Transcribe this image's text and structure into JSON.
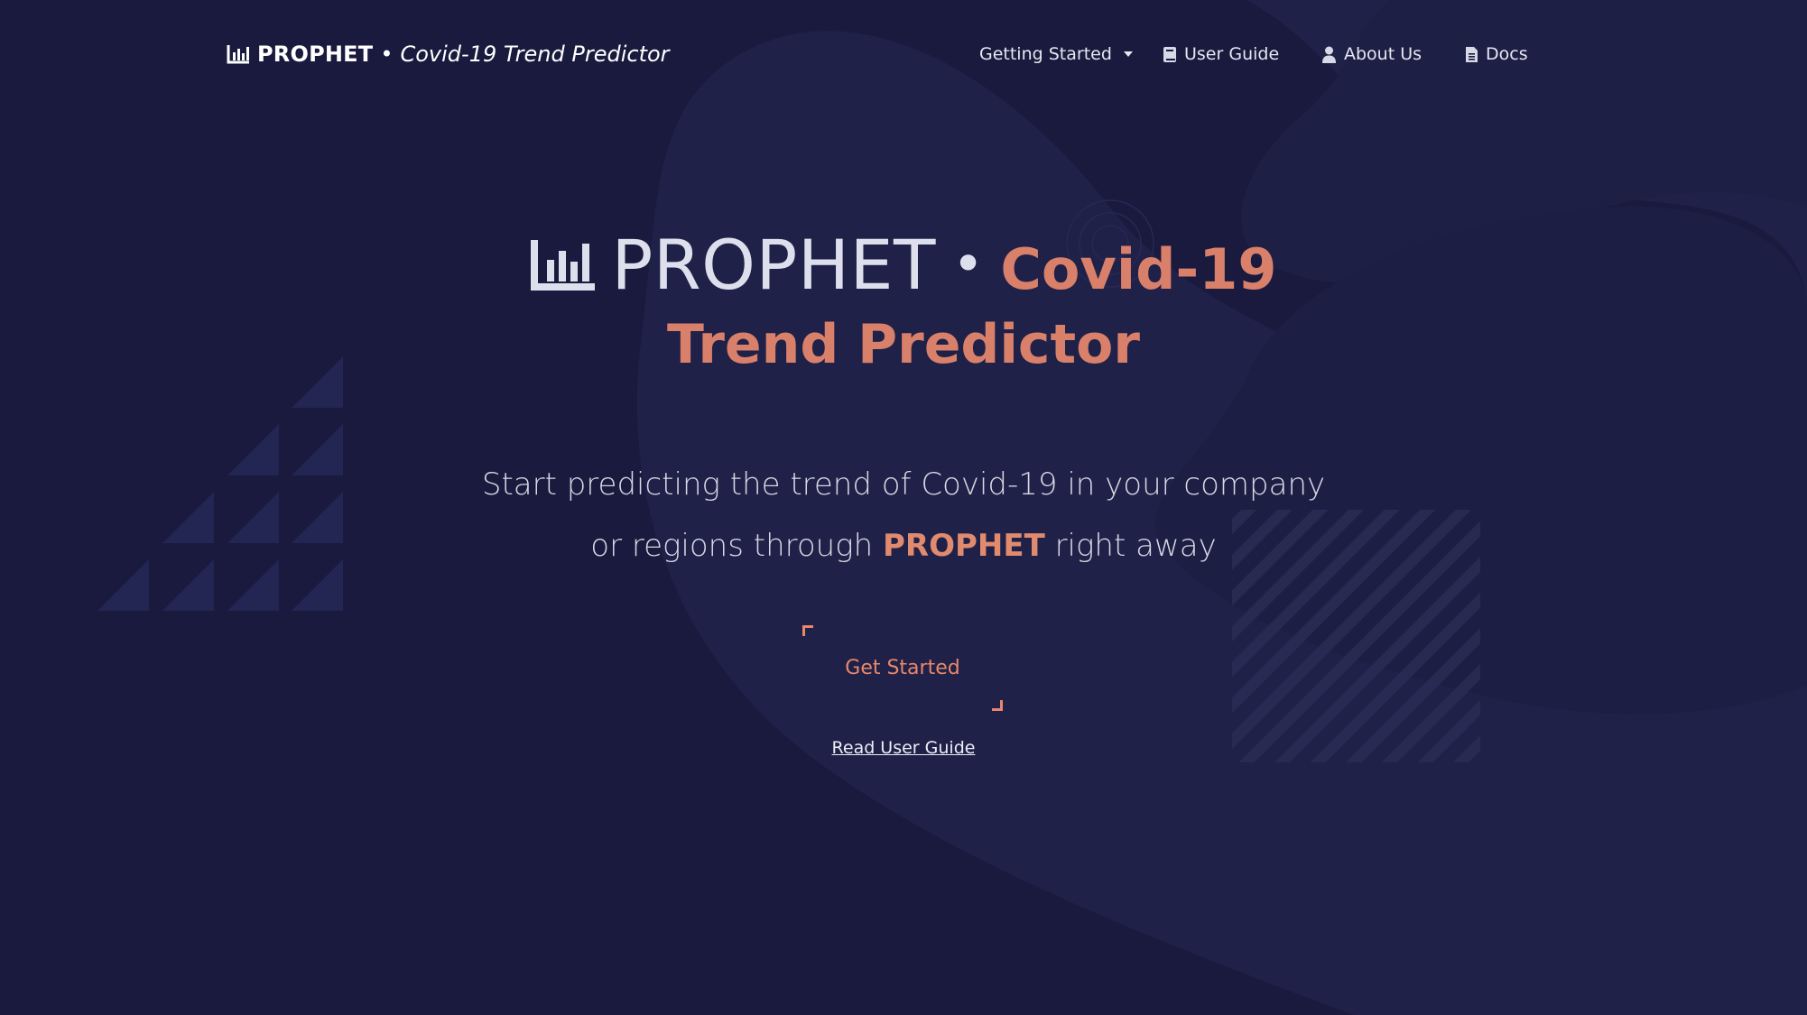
{
  "navbar": {
    "brand_name": "PROPHET",
    "brand_separator": "•",
    "brand_tagline": "Covid-19 Trend Predictor",
    "brand_icon": "chart-bar-icon",
    "items": [
      {
        "label": "Getting Started",
        "icon": "caret-down-icon"
      },
      {
        "label": "User Guide",
        "icon": "book-icon"
      },
      {
        "label": "About Us",
        "icon": "user-icon"
      },
      {
        "label": "Docs",
        "icon": "file-icon"
      }
    ]
  },
  "hero": {
    "brand": "PROPHET",
    "separator": "•",
    "highlight_line1": "Covid-19",
    "highlight_line2": "Trend Predictor",
    "subtitle_line1": "Start predicting the trend of Covid-19 in your company",
    "subtitle_line2_pre": "or regions through",
    "subtitle_line2_highlight": "PROPHET",
    "subtitle_line2_post": "right away",
    "cta_label": "Get Started",
    "secondary_link": "Read User Guide"
  },
  "colors": {
    "background": "#191a3e",
    "accent": "#d9806a",
    "text": "#dde0ec"
  }
}
